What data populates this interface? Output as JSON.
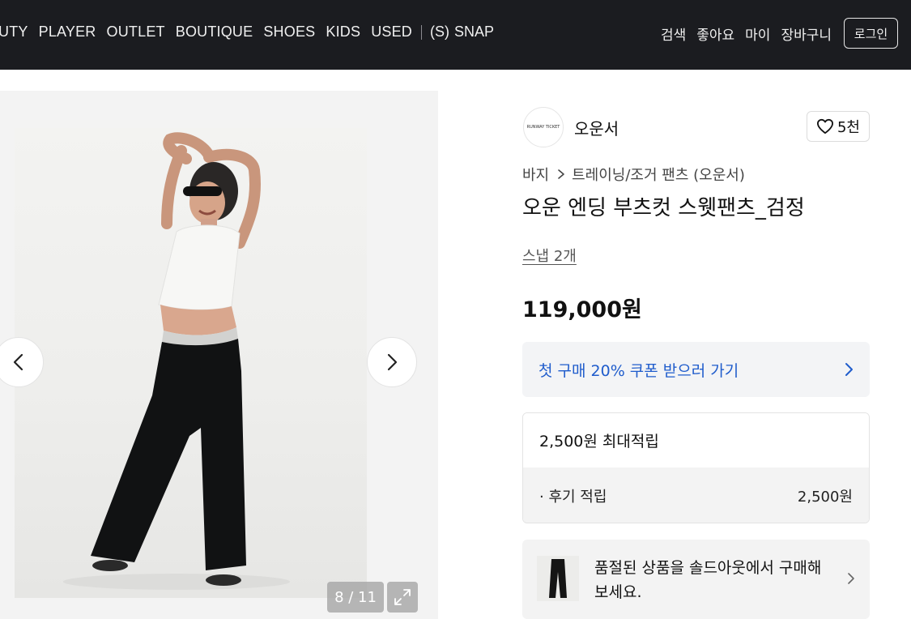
{
  "nav": {
    "categories": [
      "UTY",
      "PLAYER",
      "OUTLET",
      "BOUTIQUE",
      "SHOES",
      "KIDS",
      "USED"
    ],
    "snap_label": "SNAP",
    "snap_icon": "S",
    "utilities": [
      "검색",
      "좋아요",
      "마이",
      "장바구니"
    ],
    "login_label": "로그인"
  },
  "gallery": {
    "counter": "8 / 11",
    "prev_icon": "chevron-left-icon",
    "next_icon": "chevron-right-icon",
    "expand_icon": "expand-icon"
  },
  "product": {
    "brand_logo_text": "RUNWAY TICKET",
    "brand_name": "오운서",
    "likes": "5천",
    "breadcrumb": [
      "바지",
      "트레이닝/조거 팬츠 (오운서)"
    ],
    "title": "오운 엔딩 부츠컷 스웻팬츠_검정",
    "snap_link": "스냅 2개",
    "price": "119,000원",
    "coupon_text": "첫 구매 20% 쿠폰 받으러 가기",
    "points_header": "2,500원 최대적립",
    "points_label": "· 후기 적립",
    "points_value": "2,500원",
    "soldout_text": "품절된 상품을 솔드아웃에서 구매해 보세요."
  },
  "colors": {
    "nav_bg": "#1b1c20",
    "coupon_text": "#1f5ccc",
    "panel_bg": "#f3f3f3"
  }
}
